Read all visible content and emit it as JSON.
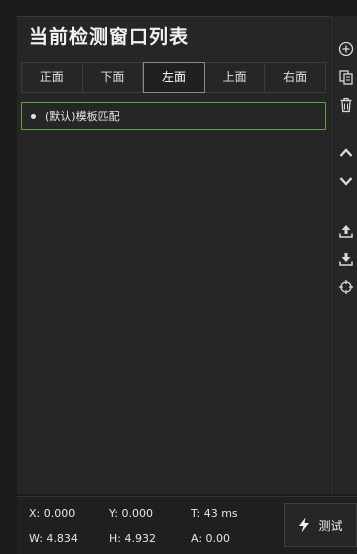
{
  "panel": {
    "title": "当前检测窗口列表",
    "tabs": [
      {
        "label": "正面",
        "active": false
      },
      {
        "label": "下面",
        "active": false
      },
      {
        "label": "左面",
        "active": true
      },
      {
        "label": "上面",
        "active": false
      },
      {
        "label": "右面",
        "active": false
      }
    ],
    "items": [
      {
        "label": "(默认)模板匹配",
        "selected": true
      }
    ]
  },
  "toolbar": {
    "buttons": [
      {
        "icon": "add-circle-icon"
      },
      {
        "icon": "copy-icon"
      },
      {
        "icon": "trash-icon"
      },
      {
        "icon": "chevron-up-icon"
      },
      {
        "icon": "chevron-down-icon"
      },
      {
        "icon": "upload-icon"
      },
      {
        "icon": "download-icon"
      },
      {
        "icon": "crosshair-icon"
      }
    ]
  },
  "footer": {
    "x": "X: 0.000",
    "y": "Y: 0.000",
    "t": "T: 43 ms",
    "w": "W: 4.834",
    "h": "H: 4.932",
    "a": "A: 0.00",
    "test_label": "测试"
  },
  "colors": {
    "background": "#1c1c1c",
    "panel": "#262626",
    "selected_border": "#5fa13a"
  }
}
